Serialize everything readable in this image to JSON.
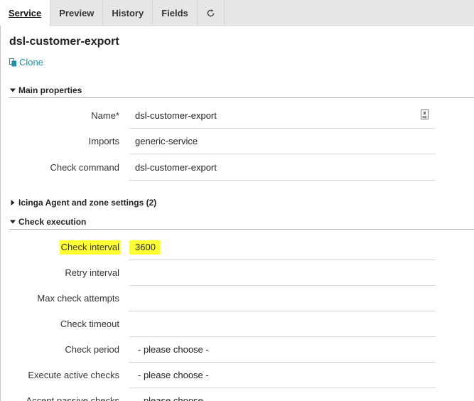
{
  "tabs": [
    {
      "label": "Service",
      "active": true
    },
    {
      "label": "Preview",
      "active": false
    },
    {
      "label": "History",
      "active": false
    },
    {
      "label": "Fields",
      "active": false
    }
  ],
  "refresh_icon": "refresh-icon",
  "title": "dsl-customer-export",
  "clone_label": "Clone",
  "sections": {
    "main": {
      "label": "Main properties",
      "expanded": true
    },
    "agent": {
      "label": "Icinga Agent and zone settings (2)",
      "expanded": false
    },
    "exec": {
      "label": "Check execution",
      "expanded": true
    }
  },
  "main_fields": {
    "name": {
      "label": "Name*",
      "value": "dsl-customer-export"
    },
    "imports": {
      "label": "Imports",
      "value": "generic-service"
    },
    "check_command": {
      "label": "Check command",
      "value": "dsl-customer-export"
    }
  },
  "exec_fields": {
    "check_interval": {
      "label": "Check interval",
      "value": "3600"
    },
    "retry_interval": {
      "label": "Retry interval",
      "value": ""
    },
    "max_check_attempts": {
      "label": "Max check attempts",
      "value": ""
    },
    "check_timeout": {
      "label": "Check timeout",
      "value": ""
    },
    "check_period": {
      "label": "Check period",
      "value": "- please choose -"
    },
    "active_checks": {
      "label": "Execute active checks",
      "value": "- please choose -"
    },
    "passive_checks": {
      "label": "Accept passive checks",
      "value": "- please choose -"
    }
  },
  "colors": {
    "highlight": "#ffff33",
    "link": "#1f8fa8",
    "tabbar": "#e6e6e6"
  }
}
